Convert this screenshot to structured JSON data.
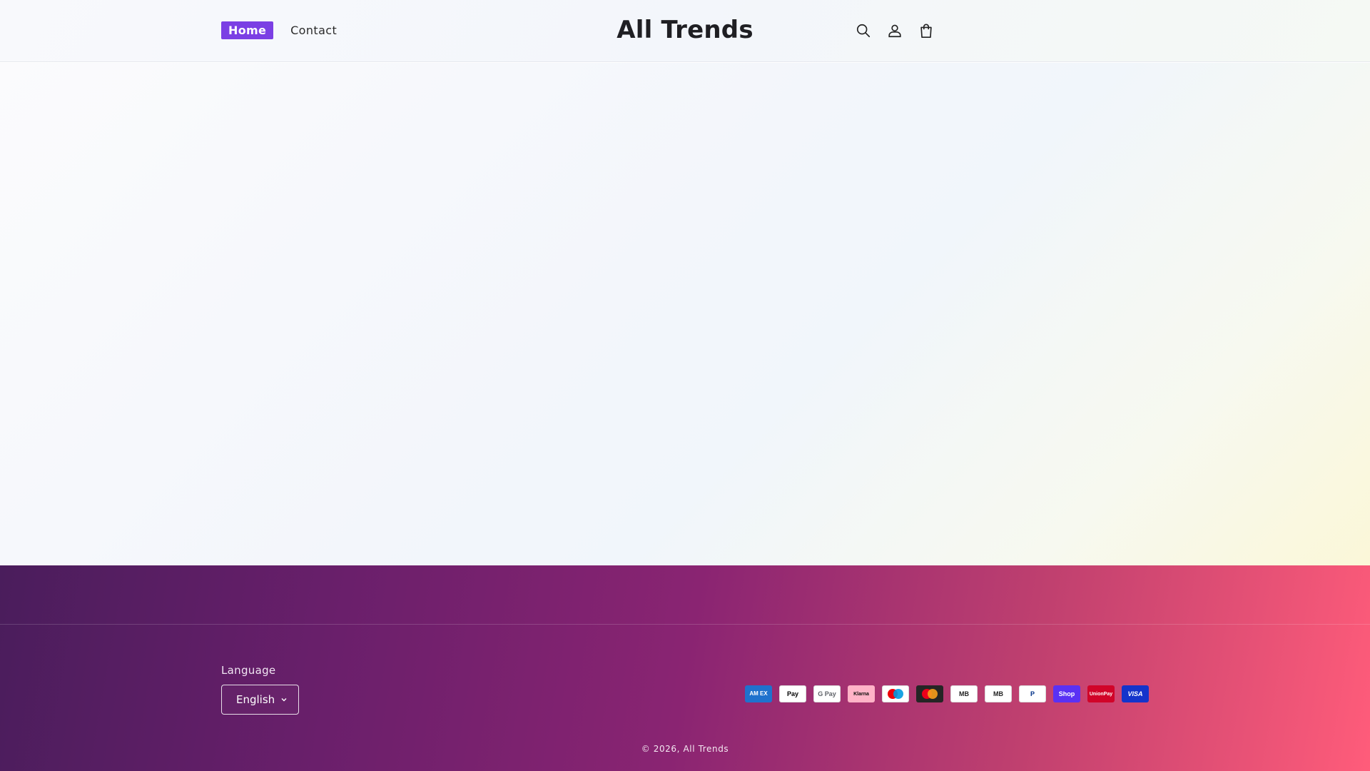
{
  "header": {
    "nav": [
      {
        "label": "Home",
        "active": true
      },
      {
        "label": "Contact",
        "active": false
      }
    ],
    "brand": "All Trends",
    "icons": [
      "search-icon",
      "account-icon",
      "cart-icon"
    ]
  },
  "footer": {
    "language_label": "Language",
    "language_value": "English",
    "payments": [
      {
        "name": "American Express",
        "text": "AM EX",
        "bg": "#1f72cd",
        "fg": "#ffffff"
      },
      {
        "name": "Apple Pay",
        "text": "Pay",
        "bg": "#ffffff",
        "fg": "#000000"
      },
      {
        "name": "Google Pay",
        "text": "G Pay",
        "bg": "#ffffff",
        "fg": "#5f6368"
      },
      {
        "name": "Klarna",
        "text": "Klarna",
        "bg": "#ffb3c7",
        "fg": "#0a0b09"
      },
      {
        "name": "Maestro",
        "text": "",
        "bg": "#ffffff",
        "fg": "#000000"
      },
      {
        "name": "Mastercard",
        "text": "",
        "bg": "#252525",
        "fg": "#ffffff"
      },
      {
        "name": "MB Way",
        "text": "MB",
        "bg": "#ffffff",
        "fg": "#222222"
      },
      {
        "name": "Multibanco",
        "text": "MB",
        "bg": "#ffffff",
        "fg": "#222222"
      },
      {
        "name": "PayPal",
        "text": "P",
        "bg": "#ffffff",
        "fg": "#003087"
      },
      {
        "name": "Shop Pay",
        "text": "Shop",
        "bg": "#5a31f4",
        "fg": "#ffffff"
      },
      {
        "name": "UnionPay",
        "text": "UnionPay",
        "bg": "#d10429",
        "fg": "#ffffff"
      },
      {
        "name": "Visa",
        "text": "VISA",
        "bg": "#1434cb",
        "fg": "#ffffff"
      }
    ],
    "copyright": "© 2026, All Trends"
  },
  "colors": {
    "accent": "#7b3fe4",
    "footer_start": "#4a1d5c",
    "footer_end": "#ff5c7a"
  }
}
